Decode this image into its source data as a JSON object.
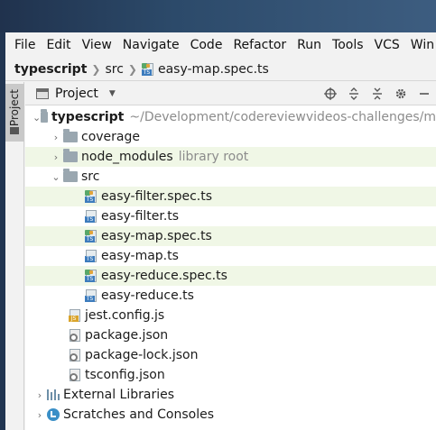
{
  "menu": [
    "File",
    "Edit",
    "View",
    "Navigate",
    "Code",
    "Refactor",
    "Run",
    "Tools",
    "VCS",
    "Win"
  ],
  "breadcrumb": {
    "root": "typescript",
    "folder": "src",
    "file": "easy-map.spec.ts"
  },
  "side_tab": {
    "label": "Project"
  },
  "panel": {
    "title": "Project"
  },
  "tree": {
    "root": {
      "name": "typescript",
      "path": "~/Development/codereviewvideos-challenges/m"
    },
    "coverage": "coverage",
    "node_modules": {
      "name": "node_modules",
      "note": "library root"
    },
    "src": "src",
    "files": [
      "easy-filter.spec.ts",
      "easy-filter.ts",
      "easy-map.spec.ts",
      "easy-map.ts",
      "easy-reduce.spec.ts",
      "easy-reduce.ts"
    ],
    "jest": "jest.config.js",
    "package": "package.json",
    "package_lock": "package-lock.json",
    "tsconfig": "tsconfig.json",
    "external": "External Libraries",
    "scratches": "Scratches and Consoles"
  }
}
